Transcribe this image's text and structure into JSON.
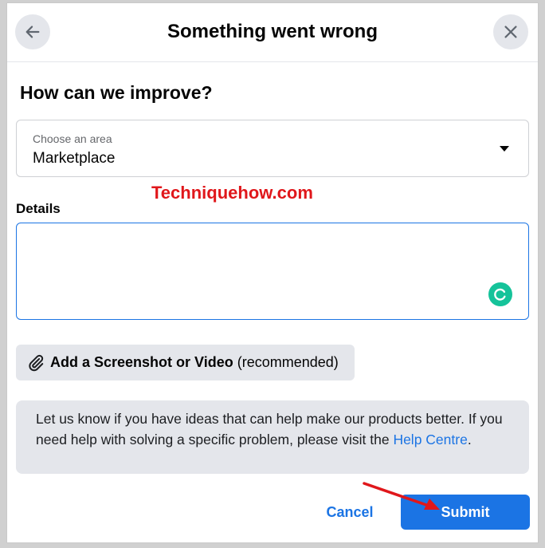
{
  "header": {
    "title": "Something went wrong",
    "back_icon": "arrow-left-icon",
    "close_icon": "close-icon"
  },
  "form": {
    "heading": "How can we improve?",
    "area_select": {
      "label": "Choose an area",
      "value": "Marketplace",
      "caret_icon": "caret-down-icon"
    },
    "details": {
      "label": "Details",
      "value": "",
      "placeholder": ""
    },
    "attach_button": {
      "label": "Add a Screenshot or Video",
      "hint": "(recommended)",
      "icon": "paperclip-icon"
    },
    "info": {
      "text": "Let us know if you have ideas that can help make our products better. If you need help with solving a specific problem, please visit the ",
      "link": "Help Centre",
      "end": "."
    }
  },
  "footer": {
    "cancel_label": "Cancel",
    "submit_label": "Submit"
  },
  "watermark": "Techniquehow.com",
  "colors": {
    "accent": "#1b74e4",
    "button_gray": "#e4e6eb",
    "watermark_red": "#e0171b",
    "grammarly_green": "#15c39a"
  }
}
